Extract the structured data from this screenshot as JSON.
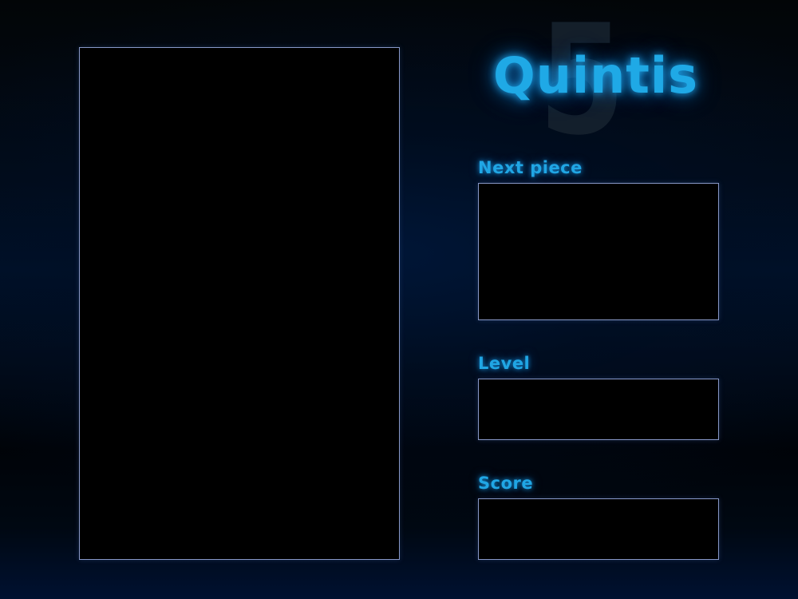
{
  "game": {
    "title": "Quintis",
    "logo_digit": "5",
    "accent_color": "#1fa9e6",
    "border_color": "#8898c8"
  },
  "next_piece": {
    "label": "Next piece"
  },
  "level": {
    "label": "Level",
    "value": ""
  },
  "score": {
    "label": "Score",
    "value": ""
  }
}
